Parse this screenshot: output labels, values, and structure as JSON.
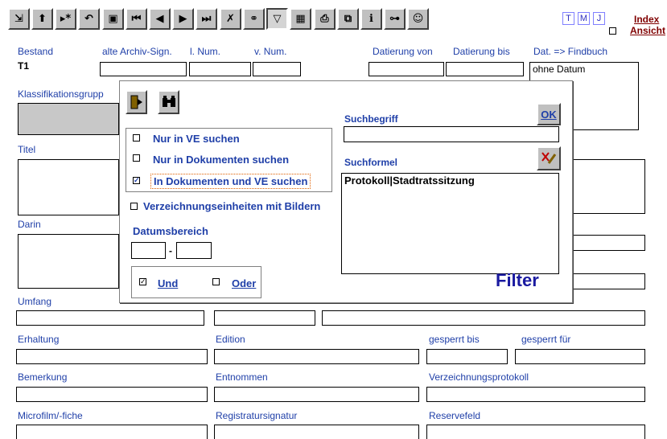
{
  "toolbar": {
    "buttons": [
      {
        "name": "exit-door-icon",
        "glyph": "⇲"
      },
      {
        "name": "arrow-up-icon",
        "glyph": "⬆"
      },
      {
        "name": "new-record-icon",
        "glyph": "▸*"
      },
      {
        "name": "undo-icon",
        "glyph": "↶"
      },
      {
        "name": "save-disk-icon",
        "glyph": "▣"
      },
      {
        "name": "first-record-icon",
        "glyph": "⏮"
      },
      {
        "name": "previous-record-icon",
        "glyph": "◀"
      },
      {
        "name": "next-record-icon",
        "glyph": "▶"
      },
      {
        "name": "last-record-icon",
        "glyph": "⏭"
      },
      {
        "name": "clear-filter-icon",
        "glyph": "✗"
      },
      {
        "name": "binoculars-icon",
        "glyph": "⚭"
      },
      {
        "name": "filter-funnel-icon",
        "glyph": "▽"
      },
      {
        "name": "calendar-table-icon",
        "glyph": "▦"
      },
      {
        "name": "printer-icon",
        "glyph": "⎙"
      },
      {
        "name": "copy-add-icon",
        "glyph": "⧉"
      },
      {
        "name": "info-icon",
        "glyph": "ℹ"
      },
      {
        "name": "tree-structure-icon",
        "glyph": "⊶"
      },
      {
        "name": "smiley-icon",
        "glyph": "☺"
      }
    ],
    "tmj": [
      "T",
      "M",
      "J"
    ],
    "index_label": "Index",
    "ansicht_label": "Ansicht"
  },
  "form": {
    "bestand_label": "Bestand",
    "bestand_value": "T1",
    "alte_archiv_sign_label": "alte Archiv-Sign.",
    "l_num_label": "l. Num.",
    "v_num_label": "v. Num.",
    "datierung_von_label": "Datierung von",
    "datierung_bis_label": "Datierung bis",
    "dat_findbuch_label": "Dat. => Findbuch",
    "dat_findbuch_value": "ohne Datum",
    "klassifikationsgruppe_label": "Klassifikationsgrupp",
    "titel_label": "Titel",
    "darin_label": "Darin",
    "umfang_label": "Umfang",
    "erhaltung_label": "Erhaltung",
    "edition_label": "Edition",
    "gesperrt_bis_label": "gesperrt bis",
    "gesperrt_fuer_label": "gesperrt für",
    "bemerkung_label": "Bemerkung",
    "entnommen_label": "Entnommen",
    "verzeichnungsprotokoll_label": "Verzeichnungsprotokoll",
    "microfilm_label": "Microfilm/-fiche",
    "registratursignatur_label": "Registratursignatur",
    "reservefeld_label": "Reservefeld"
  },
  "dialog": {
    "option_nur_ve": "Nur in VE suchen",
    "option_nur_dokumente": "Nur in Dokumenten suchen",
    "option_dokumente_und_ve": "In Dokumenten und VE suchen",
    "selected_option": "option_dokumente_und_ve",
    "verzeichnungseinheiten_bilder": "Verzeichnungseinheiten mit Bildern",
    "verzeichnungseinheiten_bilder_checked": false,
    "datumsbereich_label": "Datumsbereich",
    "date_separator": "-",
    "und_label": "Und",
    "und_checked": true,
    "oder_label": "Oder",
    "oder_checked": false,
    "suchbegriff_label": "Suchbegriff",
    "suchbegriff_value": "",
    "ok_label": "OK",
    "suchformel_label": "Suchformel",
    "suchformel_value": "Protokoll|Stadtratssitzung",
    "filter_title": "Filter"
  },
  "colors": {
    "label_blue": "#1f3fa8",
    "filter_title": "#1a1aa0",
    "button_face": "#c0c0c0",
    "nav_link": "#800000"
  }
}
